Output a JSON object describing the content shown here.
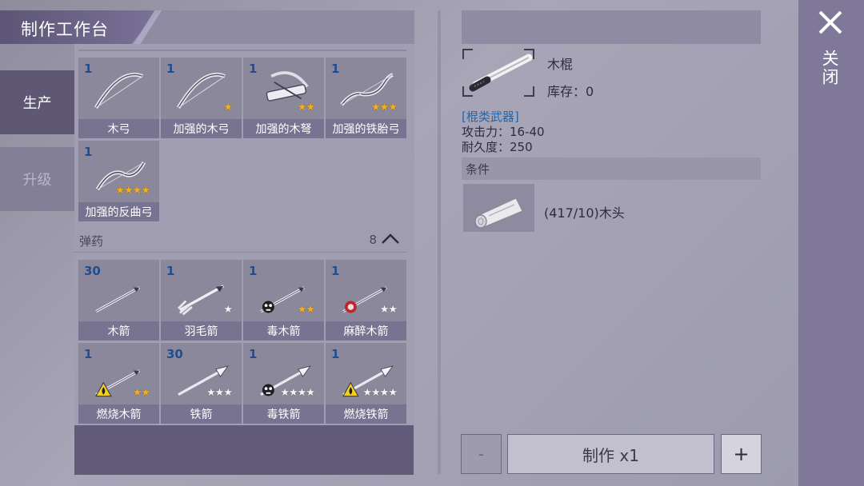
{
  "header": {
    "title": "制作工作台"
  },
  "sidebar": {
    "tabs": [
      {
        "label": "生产"
      },
      {
        "label": "升级"
      }
    ]
  },
  "weapons": [
    {
      "count": "1",
      "name": "木弓",
      "stars": 0,
      "star_color": "gold",
      "icon": "bow-icon"
    },
    {
      "count": "1",
      "name": "加强的木弓",
      "stars": 1,
      "star_color": "gold",
      "icon": "bow-icon"
    },
    {
      "count": "1",
      "name": "加强的木弩",
      "stars": 2,
      "star_color": "gold",
      "icon": "crossbow-icon"
    },
    {
      "count": "1",
      "name": "加强的铁胎弓",
      "stars": 3,
      "star_color": "gold",
      "icon": "recurve-bow-icon"
    },
    {
      "count": "1",
      "name": "加强的反曲弓",
      "stars": 4,
      "star_color": "gold",
      "icon": "composite-bow-icon"
    }
  ],
  "ammo_section": {
    "title": "弹药",
    "count": "8"
  },
  "ammo": [
    {
      "count": "30",
      "name": "木箭",
      "stars": 0,
      "star_color": "gold",
      "icon": "arrow-icon",
      "badge": ""
    },
    {
      "count": "1",
      "name": "羽毛箭",
      "stars": 1,
      "star_color": "white",
      "icon": "feather-arrow-icon",
      "badge": ""
    },
    {
      "count": "1",
      "name": "毒木箭",
      "stars": 2,
      "star_color": "gold",
      "icon": "poison-arrow-icon",
      "badge": "skull"
    },
    {
      "count": "1",
      "name": "麻醉木箭",
      "stars": 2,
      "star_color": "white",
      "icon": "tranq-arrow-icon",
      "badge": "tranq"
    },
    {
      "count": "1",
      "name": "燃烧木箭",
      "stars": 2,
      "star_color": "gold",
      "icon": "fire-arrow-icon",
      "badge": "fire"
    },
    {
      "count": "30",
      "name": "铁箭",
      "stars": 3,
      "star_color": "white",
      "icon": "iron-arrow-icon",
      "badge": ""
    },
    {
      "count": "1",
      "name": "毒铁箭",
      "stars": 4,
      "star_color": "white",
      "icon": "poison-iron-arrow-icon",
      "badge": "skull"
    },
    {
      "count": "1",
      "name": "燃烧铁箭",
      "stars": 4,
      "star_color": "white",
      "icon": "fire-iron-arrow-icon",
      "badge": "fire"
    }
  ],
  "detail": {
    "name": "木棍",
    "stock_label": "库存：",
    "stock_value": "0",
    "category": "[棍类武器]",
    "attack": "攻击力：16-40",
    "durability": "耐久度：250",
    "conditions_title": "条件",
    "material": "(417/10)木头"
  },
  "actions": {
    "minus": "-",
    "craft": "制作 x1",
    "plus": "+"
  },
  "close": {
    "label": "关闭"
  },
  "colors": {
    "count_blue": "#1f4d8f",
    "category_blue": "#2466a9",
    "star_gold": "#f2b01c"
  }
}
